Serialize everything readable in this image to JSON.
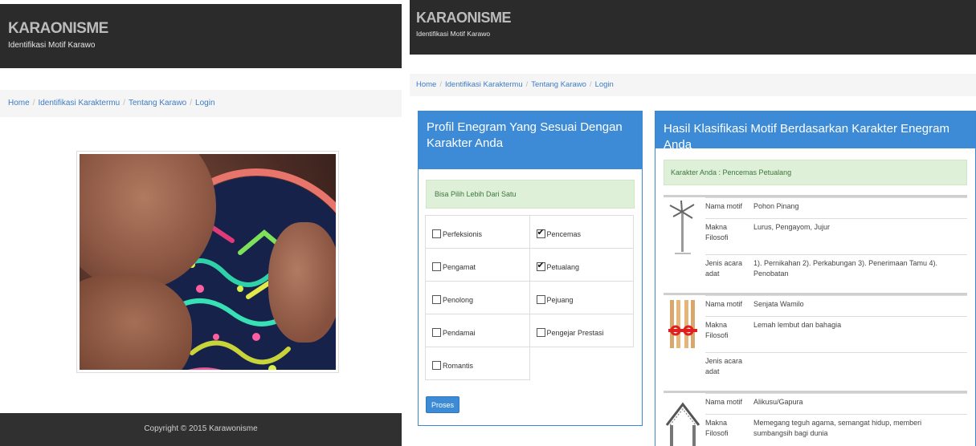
{
  "left_page": {
    "brand_title": "KARAONISME",
    "brand_subtitle": "Identifikasi Motif Karawo",
    "breadcrumb": [
      "Home",
      "Identifikasi Karaktermu",
      "Tentang Karawo",
      "Login"
    ],
    "breadcrumb_separator": "/",
    "footer": "Copyright © 2015 Karawonisme"
  },
  "right_page": {
    "brand_title": "KARAONISME",
    "brand_subtitle": "Identifikasi Motif Karawo",
    "breadcrumb": [
      "Home",
      "Identifikasi Karaktermu",
      "Tentang Karawo",
      "Login"
    ],
    "breadcrumb_separator": "/",
    "profile_panel": {
      "title": "Profil Enegram Yang Sesuai Dengan Karakter Anda",
      "hint": "Bisa Pilih Lebih Dari Satu",
      "traits": [
        {
          "label": "Perfeksionis",
          "checked": false
        },
        {
          "label": "Pencemas",
          "checked": true
        },
        {
          "label": "Pengamat",
          "checked": false
        },
        {
          "label": "Petualang",
          "checked": true
        },
        {
          "label": "Penolong",
          "checked": false
        },
        {
          "label": "Pejuang",
          "checked": false
        },
        {
          "label": "Pendamai",
          "checked": false
        },
        {
          "label": "Pengejar Prestasi",
          "checked": false
        },
        {
          "label": "Romantis",
          "checked": false
        }
      ],
      "submit_label": "Proses"
    },
    "result_panel": {
      "title": "Hasil Klasifikasi Motif Berdasarkan Karakter Enegram Anda",
      "karakter_info": "Karakter Anda : Pencemas Petualang",
      "field_labels": {
        "nama": "Nama motif",
        "makna": "Makna Filosofi",
        "jenis": "Jenis acara adat"
      },
      "motifs": [
        {
          "nama": "Pohon Pinang",
          "makna": "Lurus, Pengayom, Jujur",
          "jenis": "1). Pernikahan 2). Perkabungan 3). Penerimaan Tamu 4). Penobatan",
          "icon": "palm-tree-icon"
        },
        {
          "nama": "Senjata Wamilo",
          "makna": "Lemah lembut dan bahagia",
          "jenis": "",
          "icon": "wamilo-motif-icon"
        },
        {
          "nama": "Alikusu/Gapura",
          "makna": "Memegang teguh agama, semangat hidup, memberi sumbangsih bagi dunia",
          "icon": "gate-motif-icon"
        }
      ]
    }
  },
  "colors": {
    "header_dark": "#2b2b2b",
    "panel_blue": "#3d8bd6",
    "alert_green_bg": "#dff0d8",
    "alert_green_text": "#3c763d",
    "link_blue": "#3d7cc4"
  }
}
